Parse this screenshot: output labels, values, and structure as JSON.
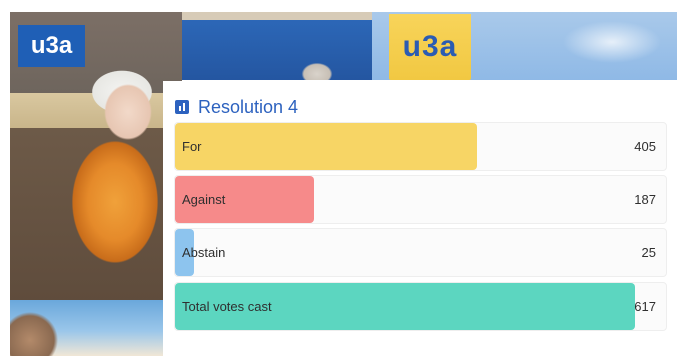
{
  "branding": {
    "logo_text": "u3a",
    "flag_text": "u3a"
  },
  "poll": {
    "title": "Resolution 4",
    "max_value": 617,
    "options": [
      {
        "label": "For",
        "value": 405,
        "color": "#f7d565"
      },
      {
        "label": "Against",
        "value": 187,
        "color": "#f68a8a"
      },
      {
        "label": "Abstain",
        "value": 25,
        "color": "#8dc4ee"
      },
      {
        "label": "Total votes cast",
        "value": 617,
        "color": "#5cd6c0"
      }
    ]
  },
  "colors": {
    "title_blue": "#2d62bf",
    "logo_blue": "#1f5fb6",
    "flag_yellow": "#f1c842"
  }
}
